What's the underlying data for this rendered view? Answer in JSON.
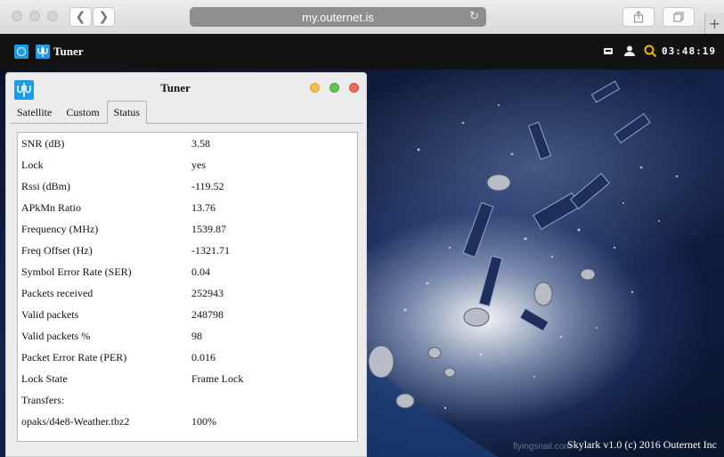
{
  "browser": {
    "url": "my.outernet.is",
    "back_glyph": "❮",
    "forward_glyph": "❯",
    "new_tab_glyph": "+"
  },
  "app_header": {
    "title": "Tuner",
    "clock": "03:48:19"
  },
  "window": {
    "title": "Tuner",
    "tabs": [
      "Satellite",
      "Custom",
      "Status"
    ],
    "active_tab": "Status",
    "status_rows": [
      {
        "label": "SNR (dB)",
        "value": "3.58"
      },
      {
        "label": "Lock",
        "value": "yes"
      },
      {
        "label": "Rssi (dBm)",
        "value": "-119.52"
      },
      {
        "label": "APkMn Ratio",
        "value": "13.76"
      },
      {
        "label": "Frequency (MHz)",
        "value": "1539.87"
      },
      {
        "label": "Freq Offset (Hz)",
        "value": "-1321.71"
      },
      {
        "label": "Symbol Error Rate (SER)",
        "value": "0.04"
      },
      {
        "label": "Packets received",
        "value": "252943"
      },
      {
        "label": "Valid packets",
        "value": "248798"
      },
      {
        "label": "Valid packets %",
        "value": "98"
      },
      {
        "label": "Packet Error Rate (PER)",
        "value": "0.016"
      },
      {
        "label": "Lock State",
        "value": "Frame Lock"
      },
      {
        "label": "Transfers:",
        "value": ""
      },
      {
        "label": "opaks/d4e8-Weather.tbz2",
        "value": "100%"
      }
    ]
  },
  "desktop": {
    "credit": "Skylark v1.0 (c) 2016 Outernet Inc",
    "watermark": "flyingsnail.com"
  },
  "colors": {
    "accent": "#1e9be8",
    "minimize": "#f5bf4f",
    "zoom": "#62c554",
    "close": "#ed6a5e",
    "header_bg": "#121212"
  }
}
